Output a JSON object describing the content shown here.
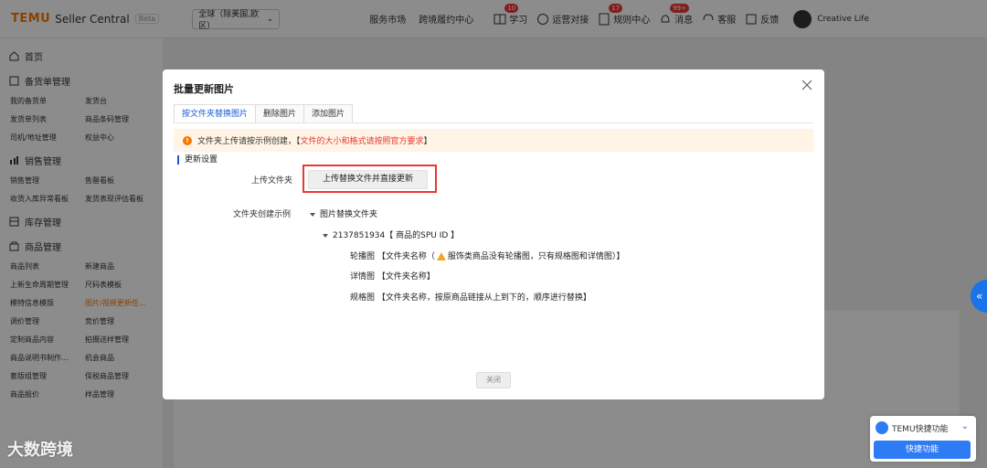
{
  "app": {
    "brand": "TEMU",
    "name": "Seller Central",
    "beta": "Beta"
  },
  "header": {
    "region": "全球（除美国,欧区）",
    "nav": [
      "服务市场",
      "跨境履约中心"
    ],
    "icons": [
      {
        "icon": "study-icon",
        "label": "学习",
        "badge": "10"
      },
      {
        "icon": "chat-icon",
        "label": "运营对接",
        "badge": ""
      },
      {
        "icon": "rules-icon",
        "label": "规则中心",
        "badge": "17"
      },
      {
        "icon": "bell-icon",
        "label": "消息",
        "badge": "99+"
      },
      {
        "icon": "service-icon",
        "label": "客服",
        "badge": ""
      },
      {
        "icon": "feedback-icon",
        "label": "反馈",
        "badge": ""
      }
    ],
    "user": "Creative Life"
  },
  "sidebar": {
    "home": "首页",
    "sections": [
      {
        "title": "备货单管理",
        "items": [
          "我的备货单",
          "发货台",
          "发货单列表",
          "商品条码管理",
          "司机/地址管理",
          "权益中心"
        ]
      },
      {
        "title": "销售管理",
        "items": [
          "销售管理",
          "售罄看板",
          "收货入库异常看板",
          "发货表现评估看板"
        ]
      },
      {
        "title": "库存管理",
        "items": []
      },
      {
        "title": "商品管理",
        "items": [
          "商品列表",
          "新建商品",
          "上新生命周期管理",
          "尺码表模板",
          "模特信息模版",
          "图片/视频更新任...",
          "调价管理",
          "竞价管理",
          "定制商品内容",
          "拍摄送样管理",
          "商品说明书制作...",
          "机会商品",
          "套版组管理",
          "保税商品管理",
          "商品报价",
          "样品管理"
        ]
      }
    ],
    "active_item": "图片/视频更新任..."
  },
  "modal": {
    "title": "批量更新图片",
    "tabs": [
      "按文件夹替换图片",
      "删除图片",
      "添加图片"
    ],
    "notice_prefix": "文件夹上传请按示例创建，【",
    "notice_highlight": "文件的大小和格式请按照官方要求",
    "notice_suffix": "】",
    "section_title": "更新设置",
    "upload_label": "上传文件夹",
    "upload_button": "上传替换文件并直接更新",
    "example_label": "文件夹创建示例",
    "tree_root": "图片替换文件夹",
    "tree_spu": "2137851934【 商品的SPU ID 】",
    "tree_line1_a": "轮播图 【文件夹名称（",
    "tree_line1_b": "服饰类商品没有轮播图，只有规格图和详情图）】",
    "tree_line2": "详情图 【文件夹名称】",
    "tree_line3": "规格图 【文件夹名称，按原商品链接从上到下的，顺序进行替换】",
    "close_button": "关闭"
  },
  "quick": {
    "title": "TEMU快捷功能",
    "button": "快捷功能"
  },
  "watermark_brand": "大数跨境",
  "colors": {
    "accent": "#fb7701",
    "primary": "#1a5bd6",
    "danger": "#e53935"
  }
}
